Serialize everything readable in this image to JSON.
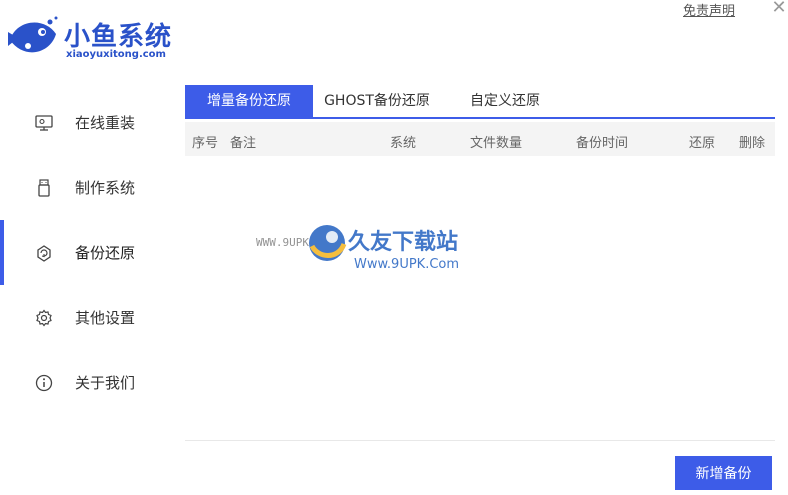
{
  "app": {
    "logo_title": "小鱼系统",
    "logo_subtitle": "xiaoyuxitong.com",
    "disclaimer": "免责声明",
    "close_glyph": "✕"
  },
  "sidebar": {
    "items": [
      {
        "label": "在线重装",
        "icon": "monitor-icon",
        "active": false
      },
      {
        "label": "制作系统",
        "icon": "usb-drive-icon",
        "active": false
      },
      {
        "label": "备份还原",
        "icon": "backup-restore-icon",
        "active": true
      },
      {
        "label": "其他设置",
        "icon": "gear-icon",
        "active": false
      },
      {
        "label": "关于我们",
        "icon": "info-icon",
        "active": false
      }
    ]
  },
  "tabs": [
    {
      "label": "增量备份还原",
      "active": true
    },
    {
      "label": "GHOST备份还原",
      "active": false
    },
    {
      "label": "自定义还原",
      "active": false
    }
  ],
  "table": {
    "columns": [
      "序号",
      "备注",
      "系统",
      "文件数量",
      "备份时间",
      "还原",
      "删除"
    ],
    "rows": []
  },
  "watermark": {
    "url_left": "WWW.9UPK.COM",
    "title": "久友下载站",
    "url": "Www.9UPK.Com"
  },
  "actions": {
    "new_backup": "新增备份"
  },
  "colors": {
    "accent": "#3d5ce8",
    "logo": "#2a52c9"
  }
}
